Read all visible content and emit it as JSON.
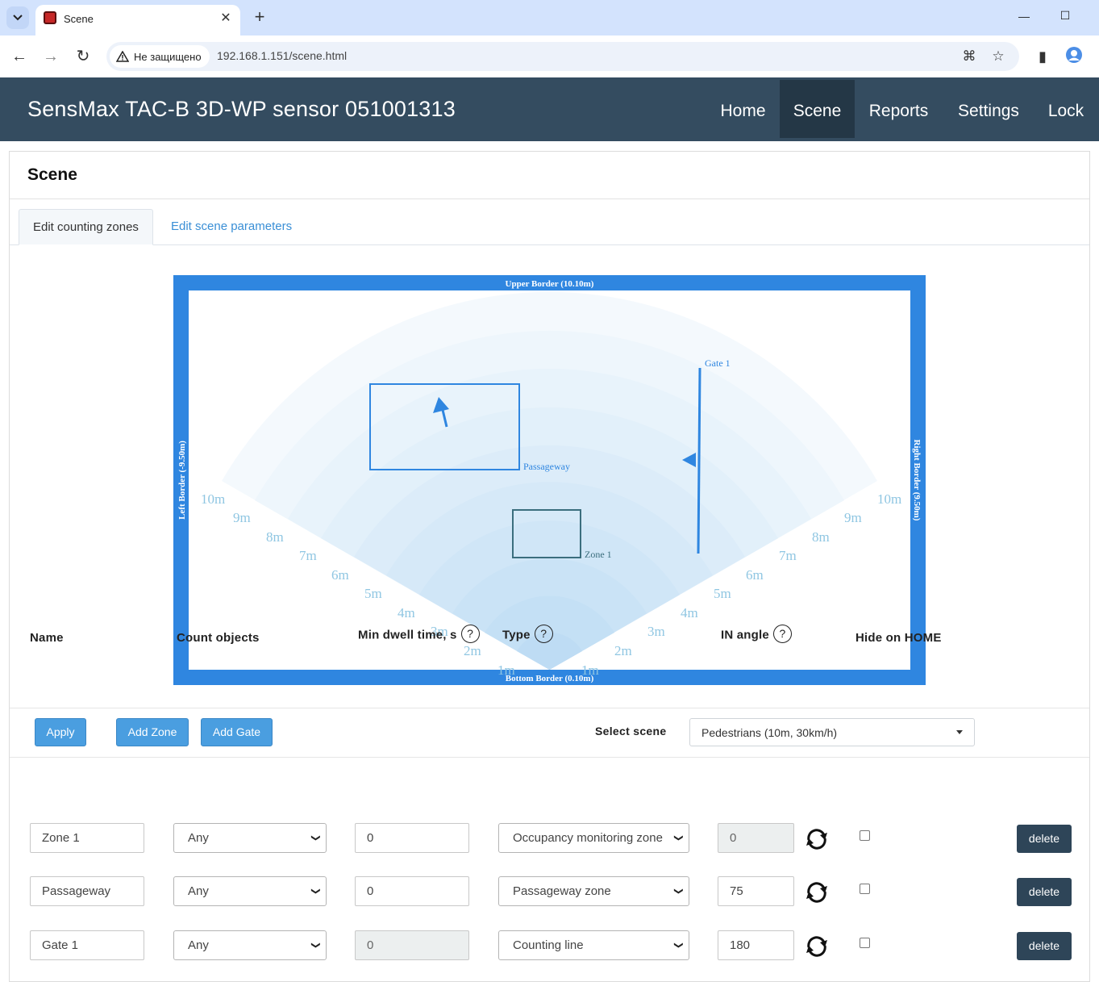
{
  "browser": {
    "tab_title": "Scene",
    "security_label": "Не защищено",
    "url": "192.168.1.151/scene.html"
  },
  "app": {
    "title": "SensMax TAC-B 3D-WP sensor 051001313",
    "nav": [
      "Home",
      "Scene",
      "Reports",
      "Settings",
      "Lock"
    ],
    "active_nav": "Scene"
  },
  "panel": {
    "title": "Scene",
    "tabs": [
      "Edit counting zones",
      "Edit scene parameters"
    ]
  },
  "scene": {
    "upper_border": "Upper Border (10.10m)",
    "bottom_border": "Bottom Border (0.10m)",
    "left_border": "Left Border (-9.50m)",
    "right_border": "Right Border (9.50m)",
    "range_labels": [
      "1m",
      "2m",
      "3m",
      "4m",
      "5m",
      "6m",
      "7m",
      "8m",
      "9m",
      "10m"
    ],
    "zones": [
      "Passageway",
      "Zone 1"
    ],
    "gate": "Gate 1",
    "frame_color": "#2f86e0",
    "zone_colors": {
      "passageway": "#2f86e0",
      "zone1": "#3b6e7e"
    }
  },
  "actions": {
    "apply": "Apply",
    "add_zone": "Add Zone",
    "add_gate": "Add Gate",
    "select_scene_label": "Select scene",
    "selected_scene": "Pedestrians (10m, 30km/h)"
  },
  "table": {
    "headers": {
      "name": "Name",
      "count": "Count objects",
      "dwell": "Min dwell time, s",
      "type": "Type",
      "angle": "IN angle",
      "hide": "Hide on HOME"
    },
    "help_symbol": "?",
    "delete_label": "delete",
    "rows": [
      {
        "name": "Zone 1",
        "count": "Any",
        "dwell": "0",
        "type": "Occupancy monitoring zone",
        "angle": "0",
        "hide": false
      },
      {
        "name": "Passageway",
        "count": "Any",
        "dwell": "0",
        "type": "Passageway zone",
        "angle": "75",
        "hide": false
      },
      {
        "name": "Gate 1",
        "count": "Any",
        "dwell": "0",
        "type": "Counting line",
        "angle": "180",
        "hide": false
      }
    ]
  }
}
